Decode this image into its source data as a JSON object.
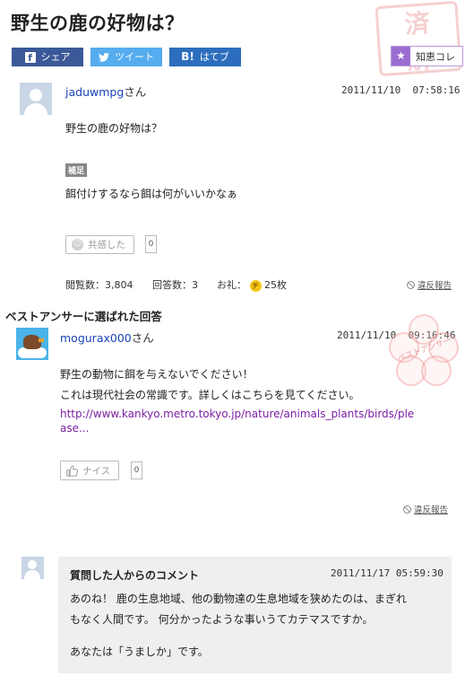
{
  "question": {
    "title": "野生の鹿の好物は？",
    "user_name": "jaduwmpg",
    "user_suffix": "さん",
    "date": "2011/11/10",
    "time": "07:58:16",
    "body": "野生の鹿の好物は？",
    "hosoku_label": "補足",
    "hosoku_text": "餌付けするなら餌は何がいいかなぁ",
    "kyokan_label": "共感した",
    "kyokan_count": "0",
    "views": "閲覧数：3,804",
    "answers": "回答数：3",
    "thanks_label": "お礼：",
    "coin_label": "チ",
    "thanks_value": "25枚",
    "report_label": "違反報告"
  },
  "stamp_resolved": [
    "済",
    "解"
  ],
  "share": {
    "facebook_icon": "f",
    "facebook": "シェア",
    "twitter": "ツイート",
    "hatena_icon": "B!",
    "hatena": "はてブ",
    "chiekore_icon": "★",
    "chiekore": "知恵コレ"
  },
  "best_answer": {
    "heading": "ベストアンサーに選ばれた回答",
    "user_name": "mogurax000",
    "user_suffix": "さん",
    "date": "2011/11/10",
    "time": "09:16:46",
    "line1": "野生の動物に餌を与えないでください！",
    "line2": "これは現代社会の常識です。詳しくはこちらを見てください。",
    "link_line1": "http://www.kankyo.metro.tokyo.jp/nature/animals_plants/birds/ple",
    "link_line2": "ase...",
    "nice_label": "ナイス",
    "nice_count": "0",
    "report_label": "違反報告",
    "stamp_text": "ベストアンサー"
  },
  "comment": {
    "title": "質問した人からのコメント",
    "date": "2011/11/17",
    "time": "05:59:30",
    "line1": "あのね！ 鹿の生息地域、他の動物達の生息地域を狭めたのは、まぎれ",
    "line2": "もなく人間です。 何分かったような事いうてカテマスですか。",
    "line3": "あなたは「うましか」です。"
  },
  "colors": {
    "facebook": "#3b5998",
    "twitter": "#55acee",
    "hatena": "#2c6ebd",
    "chiekore": "#9b6dd2",
    "user_link": "#1a44b8",
    "url_link": "#7b1fa2"
  },
  "icons": {
    "user_avatar": "default-user-avatar",
    "answer_avatar": "bird-avatar",
    "smile": "smile-icon",
    "thumb": "thumbs-up-icon",
    "report": "no-entry-icon",
    "coin": "chie-coin-icon"
  }
}
